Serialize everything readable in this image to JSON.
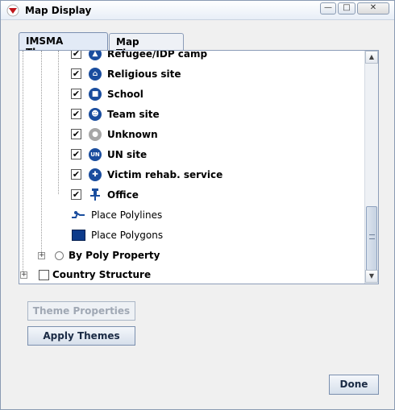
{
  "window": {
    "title": "Map Display"
  },
  "tabs": [
    {
      "label": "IMSMA Themes",
      "active": true
    },
    {
      "label": "Map Themes",
      "active": false
    }
  ],
  "tree": {
    "items": [
      {
        "label": "Refugee/IDP camp",
        "checked": true,
        "icon": "refugee-camp-icon"
      },
      {
        "label": "Religious site",
        "checked": true,
        "icon": "religious-site-icon"
      },
      {
        "label": "School",
        "checked": true,
        "icon": "school-icon"
      },
      {
        "label": "Team site",
        "checked": true,
        "icon": "team-site-icon"
      },
      {
        "label": "Unknown",
        "checked": true,
        "icon": "unknown-icon"
      },
      {
        "label": "UN site",
        "checked": true,
        "icon": "un-site-icon",
        "glyph": "UN"
      },
      {
        "label": "Victim rehab. service",
        "checked": true,
        "icon": "victim-rehab-icon"
      },
      {
        "label": "Office",
        "checked": true,
        "icon": "office-pin-icon"
      }
    ],
    "place_polylines": "Place Polylines",
    "place_polygons": "Place Polygons",
    "by_poly_property": "By Poly Property",
    "country_structure": "Country Structure",
    "check_mark": "✔"
  },
  "buttons": {
    "theme_properties": "Theme Properties",
    "apply_themes": "Apply Themes",
    "done": "Done"
  },
  "colors": {
    "icon_blue": "#1a4d9e",
    "icon_grey": "#a7a7a7",
    "polygon_fill": "#0d3a8a"
  }
}
